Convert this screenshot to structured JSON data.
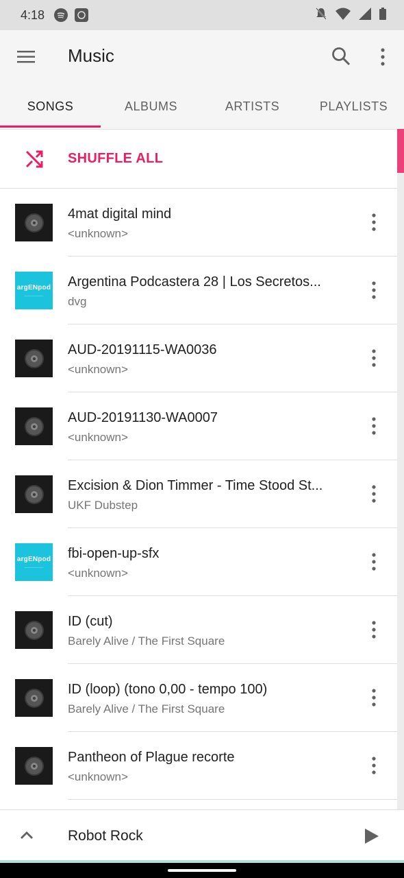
{
  "status_bar": {
    "time": "4:18"
  },
  "app_bar": {
    "title": "Music"
  },
  "tabs": [
    {
      "label": "SONGS",
      "active": true
    },
    {
      "label": "ALBUMS",
      "active": false
    },
    {
      "label": "ARTISTS",
      "active": false
    },
    {
      "label": "PLAYLISTS",
      "active": false
    }
  ],
  "shuffle": {
    "label": "SHUFFLE ALL"
  },
  "songs": [
    {
      "title": "4mat digital mind",
      "artist": "<unknown>",
      "art": "disc"
    },
    {
      "title": "Argentina Podcastera 28 | Los Secretos...",
      "artist": "dvg",
      "art": "argenpod"
    },
    {
      "title": "AUD-20191115-WA0036",
      "artist": "<unknown>",
      "art": "disc"
    },
    {
      "title": "AUD-20191130-WA0007",
      "artist": "<unknown>",
      "art": "disc"
    },
    {
      "title": "Excision & Dion Timmer - Time Stood St...",
      "artist": "UKF Dubstep",
      "art": "disc"
    },
    {
      "title": "fbi-open-up-sfx",
      "artist": "<unknown>",
      "art": "argenpod"
    },
    {
      "title": "ID (cut)",
      "artist": "Barely Alive / The First Square",
      "art": "disc"
    },
    {
      "title": "ID (loop) (tono 0,00 - tempo 100)",
      "artist": "Barely Alive / The First Square",
      "art": "disc"
    },
    {
      "title": "Pantheon of Plague recorte",
      "artist": "<unknown>",
      "art": "disc"
    }
  ],
  "argenpod_logo": "argENpod",
  "now_playing": {
    "title": "Robot Rock"
  },
  "colors": {
    "accent": "#e91e63",
    "appbar": "#f5f5f5",
    "statusbar": "#e0e0e0",
    "argenpod": "#1bc4dc"
  },
  "icons": {
    "menu": "menu-icon",
    "search": "search-icon",
    "more": "more-vert-icon",
    "shuffle": "shuffle-icon",
    "expand": "chevron-up-icon",
    "play": "play-icon"
  }
}
